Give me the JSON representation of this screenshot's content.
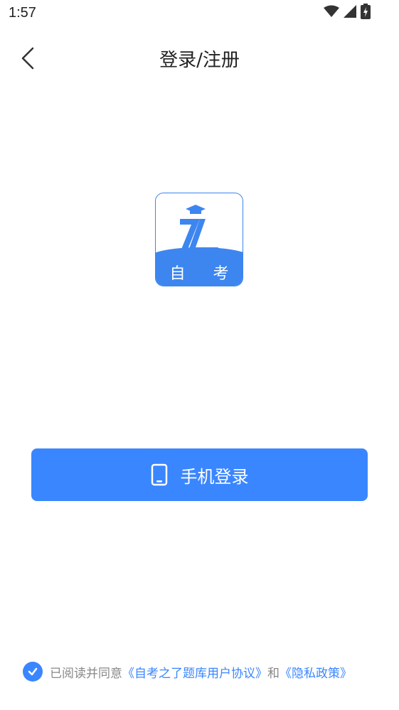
{
  "status_bar": {
    "time": "1:57",
    "icons": [
      "wifi-icon",
      "signal-icon",
      "battery-charging-icon"
    ]
  },
  "header": {
    "title": "登录/注册",
    "back_icon": "chevron-left-icon"
  },
  "logo": {
    "mark": "7L",
    "label": "自 考"
  },
  "login": {
    "label": "手机登录",
    "icon": "phone-icon"
  },
  "agreement": {
    "checked": true,
    "prefix": "已阅读并同意",
    "terms": "《自考之了题库用户协议》",
    "and": "和",
    "privacy": "《隐私政策》"
  },
  "colors": {
    "accent": "#3a86ff",
    "logo_blue": "#3d86f0",
    "muted_text": "#888888"
  }
}
